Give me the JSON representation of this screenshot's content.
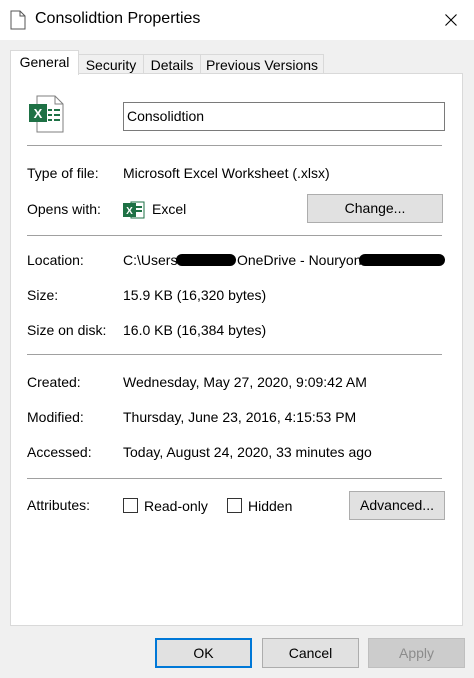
{
  "window": {
    "title": "Consolidtion Properties"
  },
  "tabs": [
    {
      "label": "General"
    },
    {
      "label": "Security"
    },
    {
      "label": "Details"
    },
    {
      "label": "Previous Versions"
    }
  ],
  "general": {
    "file_name": "Consolidtion",
    "type_label": "Type of file:",
    "type_value": "Microsoft Excel Worksheet (.xlsx)",
    "opens_label": "Opens with:",
    "opens_value": "Excel",
    "change_button": "Change...",
    "location_label": "Location:",
    "location_value_prefix": "C:\\Users",
    "location_value_middle": "OneDrive - Nouryon",
    "size_label": "Size:",
    "size_value": "15.9 KB (16,320 bytes)",
    "size_on_disk_label": "Size on disk:",
    "size_on_disk_value": "16.0 KB (16,384 bytes)",
    "created_label": "Created:",
    "created_value": "Wednesday, May 27, 2020, 9:09:42 AM",
    "modified_label": "Modified:",
    "modified_value": "Thursday, June 23, 2016, 4:15:53 PM",
    "accessed_label": "Accessed:",
    "accessed_value": "Today, August 24, 2020, 33 minutes ago",
    "attributes_label": "Attributes:",
    "readonly_label": "Read-only",
    "hidden_label": "Hidden",
    "advanced_button": "Advanced..."
  },
  "footer": {
    "ok": "OK",
    "cancel": "Cancel",
    "apply": "Apply"
  },
  "colors": {
    "excel_green": "#1e7145",
    "accent": "#0078d7"
  }
}
